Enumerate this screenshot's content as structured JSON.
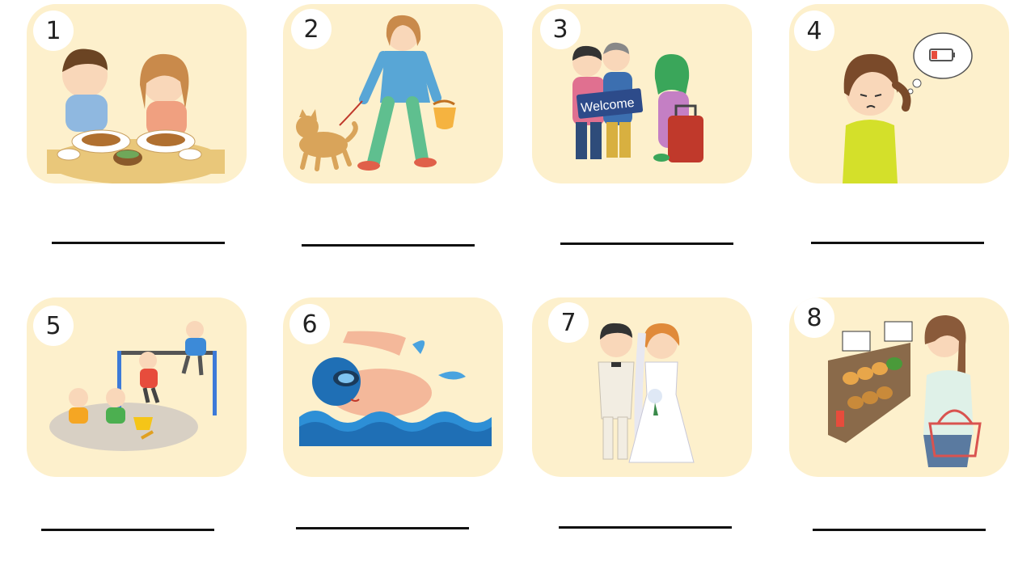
{
  "cards": [
    {
      "number": "1",
      "illustration": "children-eating-icon"
    },
    {
      "number": "2",
      "illustration": "walking-dog-icon"
    },
    {
      "number": "3",
      "illustration": "welcome-travelers-icon"
    },
    {
      "number": "4",
      "illustration": "tired-low-battery-icon"
    },
    {
      "number": "5",
      "illustration": "playground-icon"
    },
    {
      "number": "6",
      "illustration": "swimming-icon"
    },
    {
      "number": "7",
      "illustration": "wedding-couple-icon"
    },
    {
      "number": "8",
      "illustration": "grocery-shopping-icon"
    }
  ],
  "welcome_sign": "Welcome",
  "colors": {
    "card_bg": "#fdf0cc",
    "line": "#111111"
  }
}
